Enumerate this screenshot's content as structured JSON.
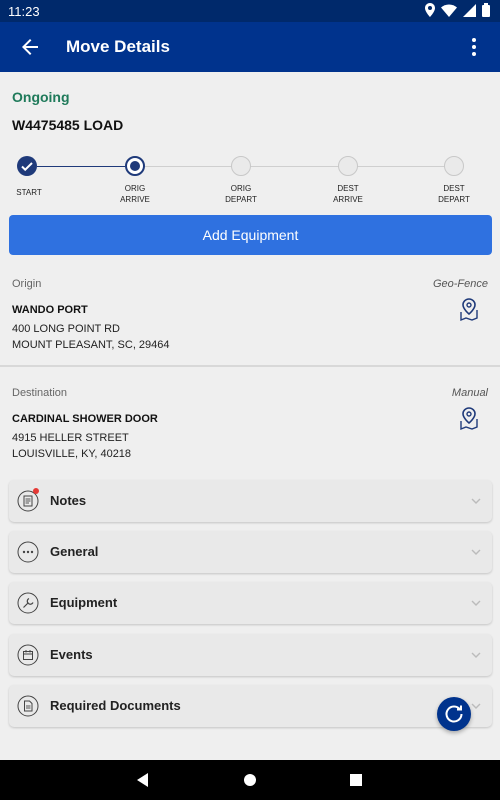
{
  "statusbar": {
    "time": "11:23"
  },
  "appbar": {
    "title": "Move Details"
  },
  "move": {
    "status": "Ongoing",
    "load": "W4475485 LOAD"
  },
  "steps": [
    {
      "label_1": "START",
      "label_2": ""
    },
    {
      "label_1": "ORIG",
      "label_2": "ARRIVE"
    },
    {
      "label_1": "ORIG",
      "label_2": "DEPART"
    },
    {
      "label_1": "DEST",
      "label_2": "ARRIVE"
    },
    {
      "label_1": "DEST",
      "label_2": "DEPART"
    }
  ],
  "add_equipment_label": "Add Equipment",
  "origin": {
    "label": "Origin",
    "tag": "Geo-Fence",
    "name": "WANDO PORT",
    "line1": "400 LONG POINT RD",
    "line2": "MOUNT PLEASANT, SC, 29464"
  },
  "destination": {
    "label": "Destination",
    "tag": "Manual",
    "name": "CARDINAL SHOWER DOOR",
    "line1": "4915 HELLER STREET",
    "line2": "LOUISVILLE, KY, 40218"
  },
  "accordions": [
    {
      "label": "Notes",
      "icon": "notes-icon"
    },
    {
      "label": "General",
      "icon": "more-circle-icon"
    },
    {
      "label": "Equipment",
      "icon": "wrench-icon"
    },
    {
      "label": "Events",
      "icon": "calendar-icon"
    },
    {
      "label": "Required Documents",
      "icon": "document-icon"
    }
  ],
  "colors": {
    "appbar": "#00338d",
    "status": "#1f7a5a",
    "button": "#2f71e0",
    "notification_dot": "#e53935"
  }
}
